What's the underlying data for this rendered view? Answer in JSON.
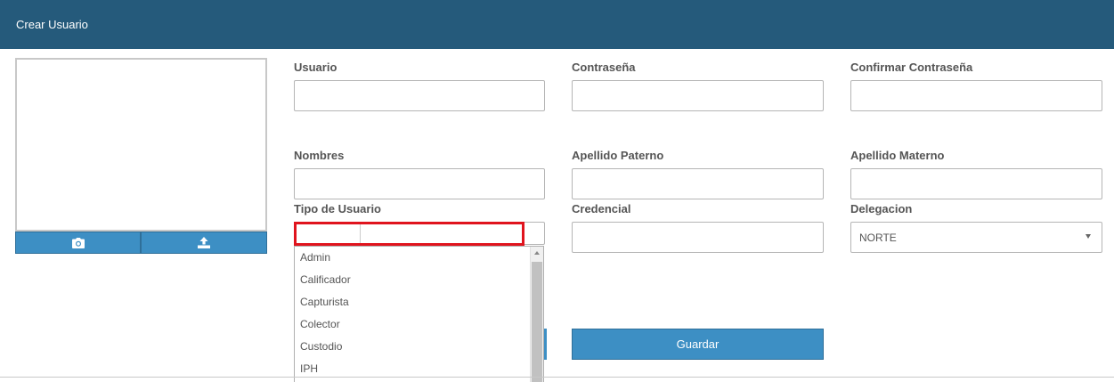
{
  "header": {
    "title": "Crear Usuario"
  },
  "photo": {
    "camera_icon": "camera-icon",
    "upload_icon": "upload-icon"
  },
  "form": {
    "usuario_label": "Usuario",
    "password_label": "Contraseña",
    "confirm_label": "Confirmar Contraseña",
    "nombres_label": "Nombres",
    "apellido_paterno_label": "Apellido Paterno",
    "apellido_materno_label": "Apellido Materno",
    "tipo_label": "Tipo de Usuario",
    "credencial_label": "Credencial",
    "delegacion_label": "Delegacion",
    "delegacion_value": "NORTE"
  },
  "tipo_dropdown": {
    "options": [
      "Admin",
      "Calificador",
      "Capturista",
      "Colector",
      "Custodio",
      "IPH"
    ]
  },
  "actions": {
    "save_label": "Guardar"
  },
  "colors": {
    "header": "#255a7b",
    "button": "#3d8fc4",
    "highlight": "#e0141e"
  }
}
